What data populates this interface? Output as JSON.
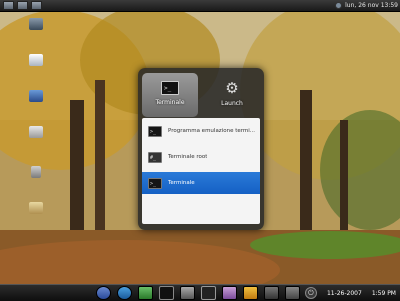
{
  "top_panel": {
    "status_text": "lun, 26 nov  13:59"
  },
  "desktop": {
    "icons": [
      {
        "label": "",
        "icon": "computer-icon"
      },
      {
        "label": "",
        "icon": "home-icon"
      },
      {
        "label": "",
        "icon": "network-icon"
      },
      {
        "label": "",
        "icon": "disk-icon"
      },
      {
        "label": "",
        "icon": "trash-icon"
      },
      {
        "label": "",
        "icon": "folder-icon"
      }
    ]
  },
  "launcher": {
    "tabs": [
      {
        "label": "Terminale",
        "icon": "terminal-icon",
        "selected": true
      },
      {
        "label": "Launch",
        "icon": "gear-icon",
        "selected": false
      }
    ],
    "results": [
      {
        "label": "Programma emulazione termi...",
        "icon": "terminal-icon",
        "selected": false
      },
      {
        "label": "Terminale root",
        "icon": "root-terminal-icon",
        "selected": false
      },
      {
        "label": "Terminale",
        "icon": "terminal-icon",
        "selected": true
      }
    ]
  },
  "dock": {
    "items": [
      "browser-icon",
      "globe-icon",
      "network-icon",
      "terminal-icon",
      "monitor-icon",
      "terminal-icon",
      "image-icon",
      "warning-icon",
      "camera-icon",
      "settings-icon"
    ],
    "date": "11-26-2007",
    "time": "1:59 PM"
  },
  "colors": {
    "selection": "#1560c4",
    "panel": "#1a1a1a"
  }
}
